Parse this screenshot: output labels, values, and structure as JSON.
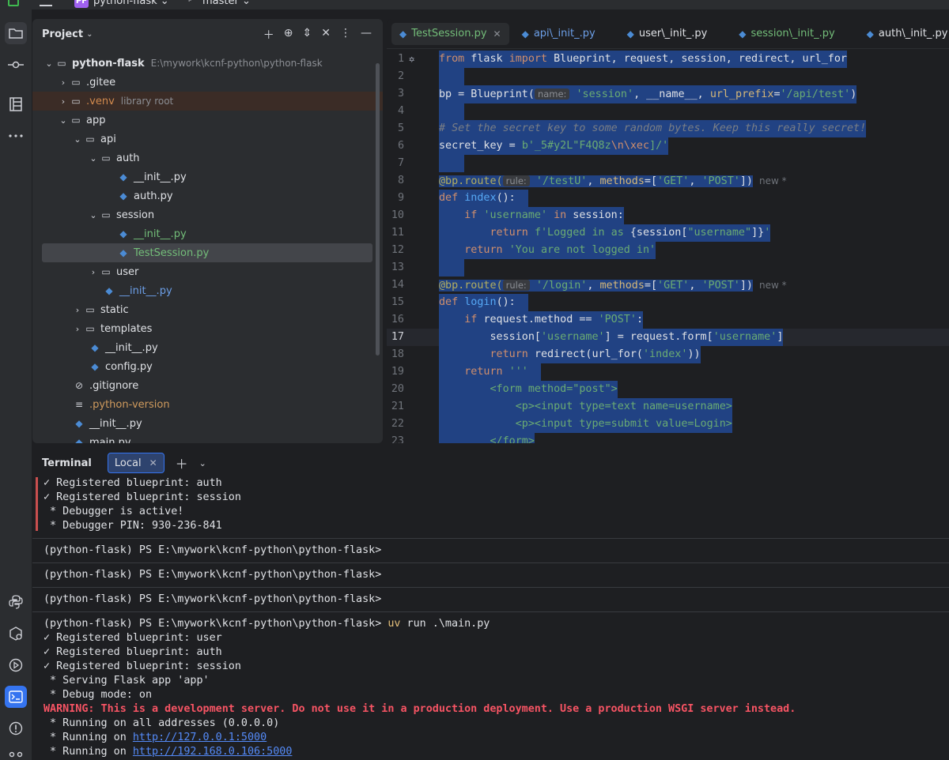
{
  "topbar": {
    "project_badge": "PF",
    "project_name": "python-flask ⌄",
    "branch_icon": "ᵖ",
    "branch": "master ⌄"
  },
  "project": {
    "title": "Project",
    "rows": [
      {
        "label": "python-flask",
        "hint": "E:\\mywork\\kcnf-python\\python-flask"
      },
      {
        "label": ".gitee"
      },
      {
        "label": ".venv",
        "hint": "library root"
      },
      {
        "label": "app"
      },
      {
        "label": "api"
      },
      {
        "label": "auth"
      },
      {
        "label": "__init__.py"
      },
      {
        "label": "auth.py"
      },
      {
        "label": "session"
      },
      {
        "label": "__init__.py"
      },
      {
        "label": "TestSession.py"
      },
      {
        "label": "user"
      },
      {
        "label": "__init__.py"
      },
      {
        "label": "static"
      },
      {
        "label": "templates"
      },
      {
        "label": "__init__.py"
      },
      {
        "label": "config.py"
      },
      {
        "label": ".gitignore"
      },
      {
        "label": ".python-version"
      },
      {
        "label": "__init__.py"
      },
      {
        "label": "main.py"
      }
    ]
  },
  "tabs": [
    {
      "label": "TestSession.py"
    },
    {
      "label": "api\\_init_.py"
    },
    {
      "label": "user\\_init_.py"
    },
    {
      "label": "session\\_init_.py"
    },
    {
      "label": "auth\\_init_.py"
    }
  ],
  "code": {
    "line_numbers": [
      "1",
      "2",
      "3",
      "4",
      "5",
      "6",
      "7",
      "8",
      "9",
      "10",
      "11",
      "12",
      "13",
      "14",
      "15",
      "16",
      "17",
      "18",
      "19",
      "20",
      "21",
      "22",
      "23"
    ],
    "l1": {
      "a": "from",
      "b": " flask ",
      "c": "import",
      "d": " Blueprint, request, session, redirect, url_for"
    },
    "l3": {
      "a": "bp = Blueprint(",
      "hint": "name:",
      "b": "'session'",
      "c": ", __name__, ",
      "d": "url_prefix",
      "e": "=",
      "f": "'/api/test'",
      "g": ")"
    },
    "l5": {
      "a": "# Set the secret key to some random bytes. Keep this really secret!"
    },
    "l6": {
      "a": "secret_key = ",
      "b": "b'_5#y2L\"F4Q8z",
      "c": "\\n\\xec",
      "d": "]/'"
    },
    "l8": {
      "a": "@bp.route(",
      "hint": "rule:",
      "b": "'/testU'",
      "c": ", ",
      "d": "methods",
      "e": "=[",
      "f": "'GET'",
      "g": ", ",
      "h": "'POST'",
      "i": "])",
      "new": "new *"
    },
    "l9": {
      "a": "def",
      "b": " index",
      "c": "():"
    },
    "l10": {
      "a": "    if ",
      "b": "'username'",
      "c": " in",
      "d": " session:"
    },
    "l11": {
      "a": "        return ",
      "b": "f'Logged in as ",
      "c": "{session[",
      "d": "\"username\"",
      "e": "]}",
      "f": "'"
    },
    "l12": {
      "a": "    return ",
      "b": "'You are not logged in'"
    },
    "l14": {
      "a": "@bp.route(",
      "hint": "rule:",
      "b": "'/login'",
      "c": ", ",
      "d": "methods",
      "e": "=[",
      "f": "'GET'",
      "g": ", ",
      "h": "'POST'",
      "i": "])",
      "new": "new *"
    },
    "l15": {
      "a": "def",
      "b": " login",
      "c": "():"
    },
    "l16": {
      "a": "    if ",
      "b": "request.method == ",
      "c": "'POST'",
      "d": ":"
    },
    "l17": {
      "a": "        session[",
      "b": "'username'",
      "c": "] = request.form[",
      "d": "'username'",
      "e": "]"
    },
    "l18": {
      "a": "        return ",
      "b": "redirect(url_for(",
      "c": "'index'",
      "d": "))"
    },
    "l19": {
      "a": "    return ",
      "b": "'''"
    },
    "l20": {
      "a": "        <form method=\"post\">"
    },
    "l21": {
      "a": "            <p><input type=text name=username>"
    },
    "l22": {
      "a": "            <p><input type=submit value=Login>"
    },
    "l23": {
      "a": "        </form>"
    }
  },
  "terminal": {
    "title": "Terminal",
    "tab": "Local",
    "top_lines": [
      "✓ Registered blueprint: auth",
      "✓ Registered blueprint: session",
      " * Debugger is active!",
      " * Debugger PIN: 930-236-841"
    ],
    "prompts": [
      "(python-flask) PS E:\\mywork\\kcnf-python\\python-flask>",
      "(python-flask) PS E:\\mywork\\kcnf-python\\python-flask>",
      "(python-flask) PS E:\\mywork\\kcnf-python\\python-flask>"
    ],
    "last_prompt": "(python-flask) PS E:\\mywork\\kcnf-python\\python-flask> ",
    "last_cmd_uv": "uv",
    "last_cmd_rest": " run .\\main.py",
    "output": [
      "✓ Registered blueprint: user",
      "✓ Registered blueprint: auth",
      "✓ Registered blueprint: session",
      " * Serving Flask app 'app'",
      " * Debug mode: on"
    ],
    "warning": "WARNING: This is a development server. Do not use it in a production deployment. Use a production WSGI server instead.",
    "running_all": " * Running on all addresses (0.0.0.0)",
    "running_prefix": " * Running on ",
    "link1": "http://127.0.0.1:5000",
    "link2": "http://192.168.0.106:5000"
  }
}
